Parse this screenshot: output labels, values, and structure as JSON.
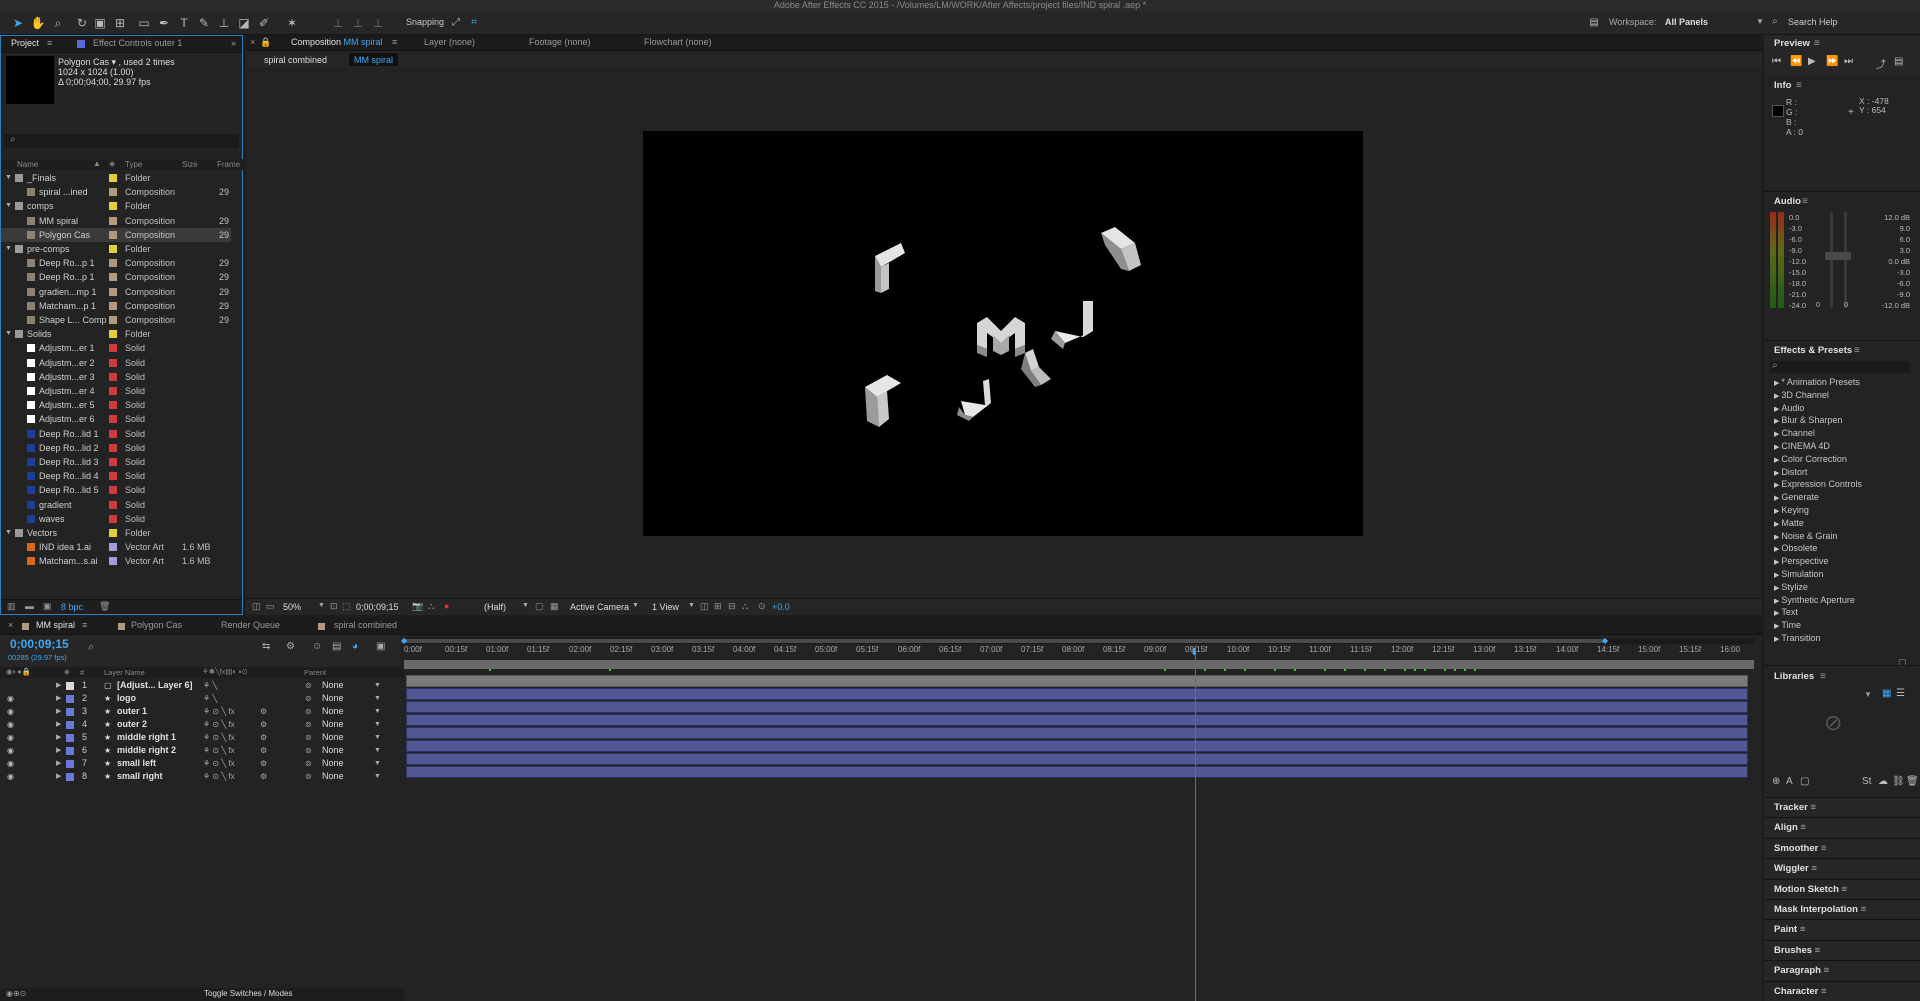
{
  "window_title": "Adobe After Effects CC 2015 - /Volumes/LM/WORK/After Affects/project files/IND spiral .aep *",
  "toolbar": {
    "snapping": "Snapping",
    "workspace_label": "Workspace:",
    "workspace_value": "All Panels",
    "search_help": "Search Help"
  },
  "project": {
    "tab_project": "Project",
    "tab_effect_controls": "Effect Controls outer 1",
    "selected_name": "Polygon Cas ▾ , used 2 times",
    "selected_dims": "1024 x 1024 (1.00)",
    "selected_duration": "Δ 0;00;04;00, 29.97 fps",
    "columns": [
      "Name",
      "Type",
      "Size",
      "Frame"
    ],
    "items": [
      {
        "name": "_Finals",
        "type": "Folder",
        "size": "",
        "frame": "",
        "kind": "folder",
        "label": "#e5cf38"
      },
      {
        "name": "spiral ...ined",
        "type": "Composition",
        "size": "",
        "frame": "29",
        "kind": "comp",
        "label": "#b39a7c"
      },
      {
        "name": "comps",
        "type": "Folder",
        "size": "",
        "frame": "",
        "kind": "folder",
        "label": "#e5cf38"
      },
      {
        "name": "MM spiral",
        "type": "Composition",
        "size": "",
        "frame": "29",
        "kind": "comp",
        "label": "#b39a7c"
      },
      {
        "name": "Polygon Cas",
        "type": "Composition",
        "size": "",
        "frame": "29",
        "kind": "comp",
        "label": "#b39a7c"
      },
      {
        "name": "pre-comps",
        "type": "Folder",
        "size": "",
        "frame": "",
        "kind": "folder",
        "label": "#e5cf38"
      },
      {
        "name": "Deep Ro...p 1",
        "type": "Composition",
        "size": "",
        "frame": "29",
        "kind": "comp",
        "label": "#b39a7c"
      },
      {
        "name": "Deep Ro...p 1",
        "type": "Composition",
        "size": "",
        "frame": "29",
        "kind": "comp",
        "label": "#b39a7c"
      },
      {
        "name": "gradien...mp 1",
        "type": "Composition",
        "size": "",
        "frame": "29",
        "kind": "comp",
        "label": "#b39a7c"
      },
      {
        "name": "Matcham...p 1",
        "type": "Composition",
        "size": "",
        "frame": "29",
        "kind": "comp",
        "label": "#b39a7c"
      },
      {
        "name": "Shape L... Comp 1",
        "type": "Composition",
        "size": "",
        "frame": "29",
        "kind": "comp",
        "label": "#b39a7c"
      },
      {
        "name": "Solids",
        "type": "Folder",
        "size": "",
        "frame": "",
        "kind": "folder",
        "label": "#e5cf38"
      },
      {
        "name": "Adjustm...er 1",
        "type": "Solid",
        "size": "",
        "frame": "",
        "kind": "white",
        "label": "#cf3b3b"
      },
      {
        "name": "Adjustm...er 2",
        "type": "Solid",
        "size": "",
        "frame": "",
        "kind": "white",
        "label": "#cf3b3b"
      },
      {
        "name": "Adjustm...er 3",
        "type": "Solid",
        "size": "",
        "frame": "",
        "kind": "white",
        "label": "#cf3b3b"
      },
      {
        "name": "Adjustm...er 4",
        "type": "Solid",
        "size": "",
        "frame": "",
        "kind": "white",
        "label": "#cf3b3b"
      },
      {
        "name": "Adjustm...er 5",
        "type": "Solid",
        "size": "",
        "frame": "",
        "kind": "white",
        "label": "#cf3b3b"
      },
      {
        "name": "Adjustm...er 6",
        "type": "Solid",
        "size": "",
        "frame": "",
        "kind": "white",
        "label": "#cf3b3b"
      },
      {
        "name": "Deep Ro...lid 1",
        "type": "Solid",
        "size": "",
        "frame": "",
        "kind": "blue",
        "label": "#cf3b3b"
      },
      {
        "name": "Deep Ro...lid 2",
        "type": "Solid",
        "size": "",
        "frame": "",
        "kind": "blue",
        "label": "#cf3b3b"
      },
      {
        "name": "Deep Ro...lid 3",
        "type": "Solid",
        "size": "",
        "frame": "",
        "kind": "blue",
        "label": "#cf3b3b"
      },
      {
        "name": "Deep Ro...lid 4",
        "type": "Solid",
        "size": "",
        "frame": "",
        "kind": "blue",
        "label": "#cf3b3b"
      },
      {
        "name": "Deep Ro...lid 5",
        "type": "Solid",
        "size": "",
        "frame": "",
        "kind": "blue",
        "label": "#cf3b3b"
      },
      {
        "name": "gradient",
        "type": "Solid",
        "size": "",
        "frame": "",
        "kind": "blue",
        "label": "#cf3b3b"
      },
      {
        "name": "waves",
        "type": "Solid",
        "size": "",
        "frame": "",
        "kind": "blue",
        "label": "#cf3b3b"
      },
      {
        "name": "Vectors",
        "type": "Folder",
        "size": "",
        "frame": "",
        "kind": "folder",
        "label": "#e5cf38"
      },
      {
        "name": "IND idea 1.ai",
        "type": "Vector Art",
        "size": "1.6 MB",
        "frame": "",
        "kind": "ai",
        "label": "#a79ad6"
      },
      {
        "name": "Matcham...s.ai",
        "type": "Vector Art",
        "size": "1.6 MB",
        "frame": "",
        "kind": "ai",
        "label": "#a79ad6"
      }
    ],
    "bpc": "8 bpc"
  },
  "viewer": {
    "tab_comp": "Composition",
    "tab_comp_name": "MM spiral",
    "tab_layer": "Layer (none)",
    "tab_footage": "Footage (none)",
    "tab_flowchart": "Flowchart (none)",
    "breadcrumb_1": "spiral combined",
    "breadcrumb_2": "MM spiral",
    "zoom": "50%",
    "timecode": "0;00;09;15",
    "resolution": "(Half)",
    "camera": "Active Camera",
    "views": "1 View",
    "exposure": "+0.0"
  },
  "right": {
    "preview": "Preview",
    "info": "Info",
    "info_r": "R :",
    "info_g": "G :",
    "info_b": "B :",
    "info_a": "A : 0",
    "info_x": "X : -478",
    "info_y": "Y : 654",
    "audio": "Audio",
    "audio_left_scale": [
      "0.0",
      "-3.0",
      "-6.0",
      "-9.0",
      "-12.0",
      "-15.0",
      "-18.0",
      "-21.0",
      "-24.0"
    ],
    "audio_right_scale": [
      "12.0 dB",
      "9.0",
      "6.0",
      "3.0",
      "0.0 dB",
      "-3.0",
      "-6.0",
      "-9.0",
      "-12.0 dB"
    ],
    "audio_zero_1": "0",
    "audio_zero_2": "0",
    "effects_presets": "Effects & Presets",
    "effects": [
      "* Animation Presets",
      "3D Channel",
      "Audio",
      "Blur & Sharpen",
      "Channel",
      "CINEMA 4D",
      "Color Correction",
      "Distort",
      "Expression Controls",
      "Generate",
      "Keying",
      "Matte",
      "Noise & Grain",
      "Obsolete",
      "Perspective",
      "Simulation",
      "Stylize",
      "Synthetic Aperture",
      "Text",
      "Time",
      "Transition"
    ],
    "libraries": "Libraries",
    "panels": [
      "Tracker",
      "Align",
      "Smoother",
      "Wiggler",
      "Motion Sketch",
      "Mask Interpolation",
      "Paint",
      "Brushes",
      "Paragraph",
      "Character"
    ]
  },
  "timeline": {
    "tab_mm": "MM spiral",
    "tab_polygon": "Polygon Cas",
    "tab_render": "Render Queue",
    "tab_spiral": "spiral combined",
    "timecode": "0;00;09;15",
    "frames": "00285 (29.97 fps)",
    "col_layer": "Layer Name",
    "col_parent": "Parent",
    "col_num": "#",
    "ticks": [
      "0:00f",
      "00:15f",
      "01:00f",
      "01:15f",
      "02:00f",
      "02:15f",
      "03:00f",
      "03:15f",
      "04:00f",
      "04:15f",
      "05:00f",
      "05:15f",
      "06:00f",
      "06:15f",
      "07:00f",
      "07:15f",
      "08:00f",
      "08:15f",
      "09:00f",
      "09:15f",
      "10:00f",
      "10:15f",
      "11:00f",
      "11:15f",
      "12:00f",
      "12:15f",
      "13:00f",
      "13:15f",
      "14:00f",
      "14:15f",
      "15:00f",
      "15:15f",
      "16:00"
    ],
    "layers": [
      {
        "num": "1",
        "name": "[Adjust... Layer 6]",
        "parent": "None",
        "color": "#d8d8d8"
      },
      {
        "num": "2",
        "name": "logo",
        "parent": "None",
        "color": "#6a78d8"
      },
      {
        "num": "3",
        "name": "outer 1",
        "parent": "None",
        "color": "#6a78d8"
      },
      {
        "num": "4",
        "name": "outer 2",
        "parent": "None",
        "color": "#6a78d8"
      },
      {
        "num": "5",
        "name": "middle right 1",
        "parent": "None",
        "color": "#6a78d8"
      },
      {
        "num": "6",
        "name": "middle right 2",
        "parent": "None",
        "color": "#6a78d8"
      },
      {
        "num": "7",
        "name": "small left",
        "parent": "None",
        "color": "#6a78d8"
      },
      {
        "num": "8",
        "name": "small right",
        "parent": "None",
        "color": "#6a78d8"
      }
    ],
    "toggle": "Toggle Switches / Modes"
  }
}
